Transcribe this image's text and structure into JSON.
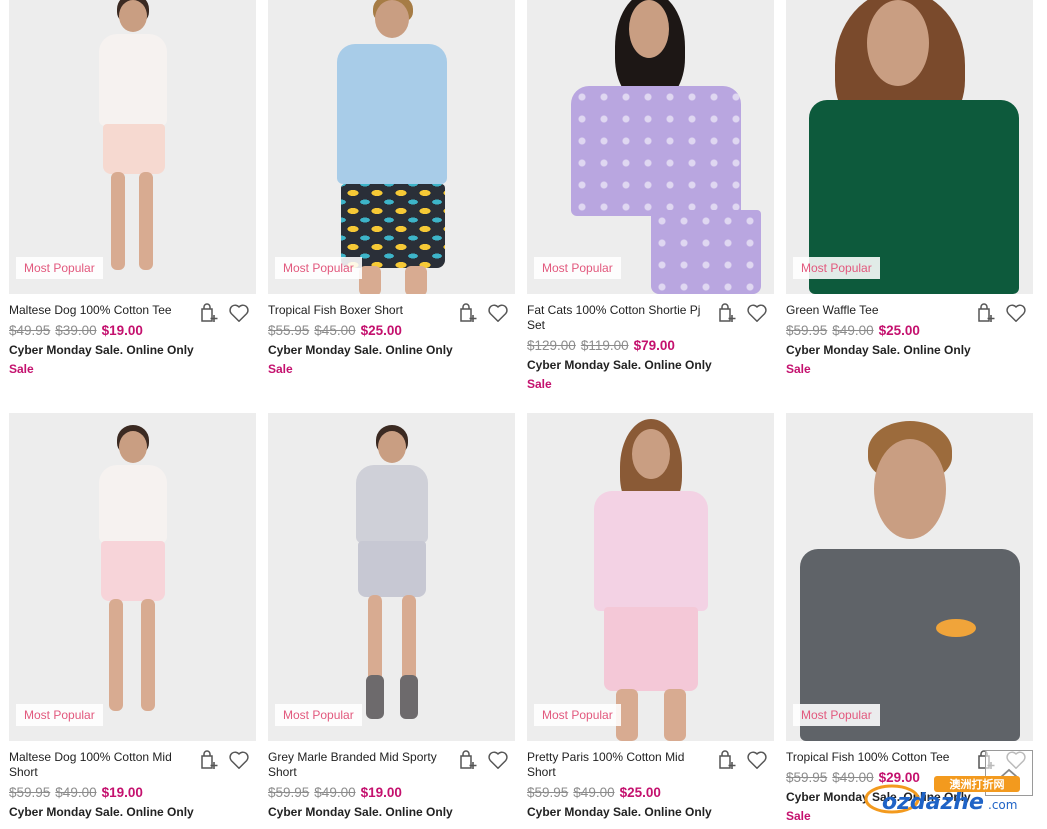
{
  "products": [
    {
      "name": "Maltese Dog 100% Cotton Tee",
      "badge": "Most Popular",
      "prices": [
        "$49.95",
        "$39.00"
      ],
      "sale_price": "$19.00",
      "promo": "Cyber Monday Sale. Online Only",
      "sale_label": "Sale"
    },
    {
      "name": "Tropical Fish Boxer Short",
      "badge": "Most Popular",
      "prices": [
        "$55.95",
        "$45.00"
      ],
      "sale_price": "$25.00",
      "promo": "Cyber Monday Sale. Online Only",
      "sale_label": "Sale"
    },
    {
      "name": "Fat Cats 100% Cotton Shortie Pj Set",
      "badge": "Most Popular",
      "prices": [
        "$129.00",
        "$119.00"
      ],
      "sale_price": "$79.00",
      "promo": "Cyber Monday Sale. Online Only",
      "sale_label": "Sale"
    },
    {
      "name": "Green Waffle Tee",
      "badge": "Most Popular",
      "prices": [
        "$59.95",
        "$49.00"
      ],
      "sale_price": "$25.00",
      "promo": "Cyber Monday Sale. Online Only",
      "sale_label": "Sale"
    },
    {
      "name": "Maltese Dog 100% Cotton Mid Short",
      "badge": "Most Popular",
      "prices": [
        "$59.95",
        "$49.00"
      ],
      "sale_price": "$19.00",
      "promo": "Cyber Monday Sale. Online Only",
      "sale_label": ""
    },
    {
      "name": "Grey Marle Branded Mid Sporty Short",
      "badge": "Most Popular",
      "prices": [
        "$59.95",
        "$49.00"
      ],
      "sale_price": "$19.00",
      "promo": "Cyber Monday Sale. Online Only",
      "sale_label": ""
    },
    {
      "name": "Pretty Paris 100% Cotton Mid Short",
      "badge": "Most Popular",
      "prices": [
        "$59.95",
        "$49.00"
      ],
      "sale_price": "$25.00",
      "promo": "Cyber Monday Sale. Online Only",
      "sale_label": ""
    },
    {
      "name": "Tropical Fish 100% Cotton Tee",
      "badge": "Most Popular",
      "prices": [
        "$59.95",
        "$49.00"
      ],
      "sale_price": "$29.00",
      "promo": "Cyber Monday Sale. Online Only",
      "sale_label": "Sale"
    }
  ],
  "watermark": {
    "text": "ozdazhe",
    "suffix": ".com",
    "chinese": "澳洲打折网"
  },
  "icons": {
    "add_to_bag": "bag-plus-icon",
    "wishlist": "heart-icon",
    "scroll_top": "chevron-up-icon"
  },
  "colors": {
    "sale_price": "#c4116e",
    "badge_text": "#e2587d",
    "was_price": "#8c8c8c"
  }
}
